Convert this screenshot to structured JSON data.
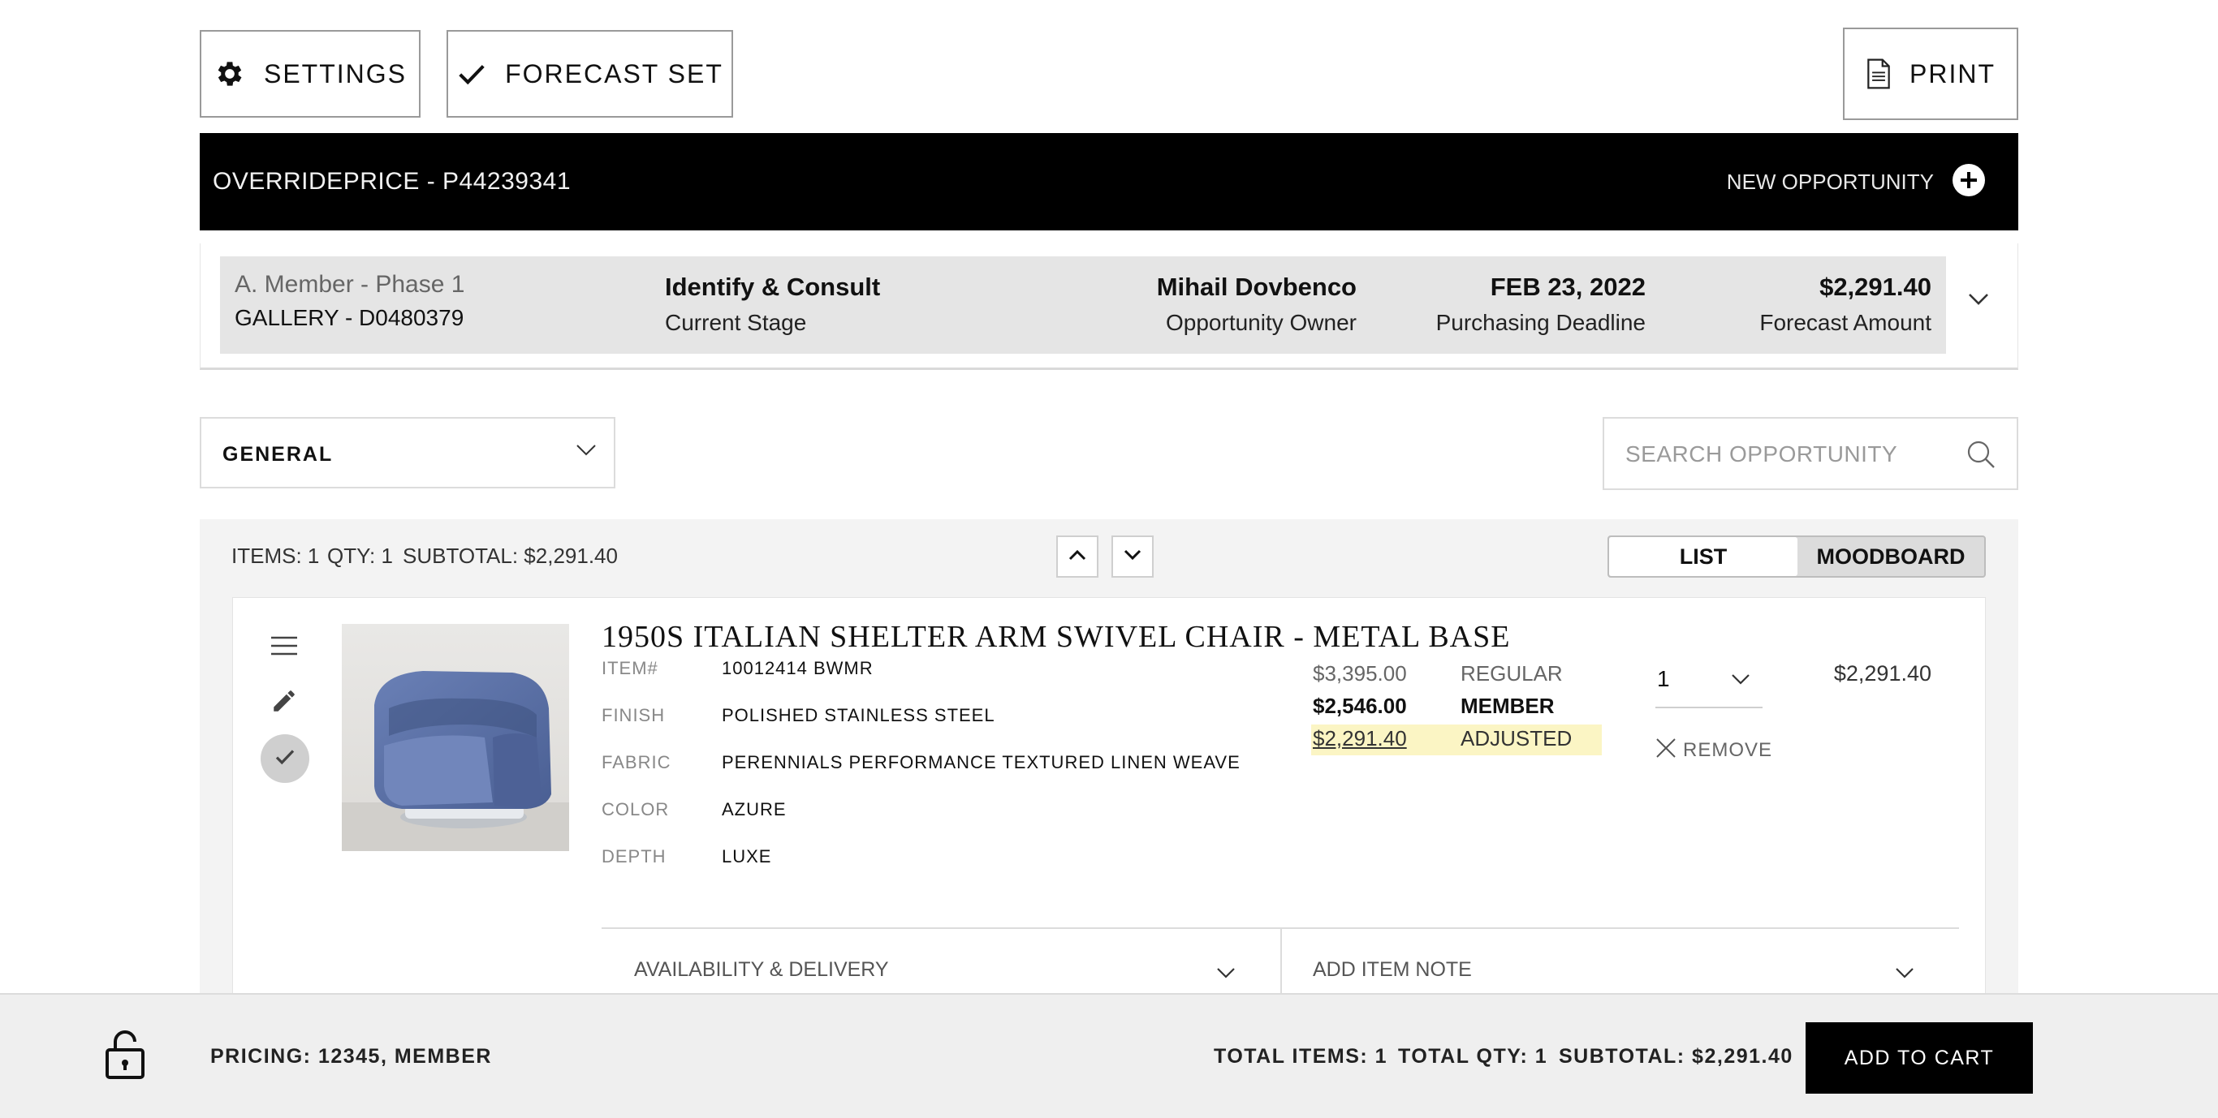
{
  "toolbar": {
    "settings_label": "SETTINGS",
    "forecast_label": "FORECAST SET",
    "print_label": "PRINT"
  },
  "header_bar": {
    "title": "OVERRIDEPRICE - P44239341",
    "new_opportunity_label": "NEW OPPORTUNITY"
  },
  "summary": {
    "member": "A. Member - Phase 1",
    "gallery": "GALLERY - D0480379",
    "stage_value": "Identify & Consult",
    "stage_label": "Current Stage",
    "owner_value": "Mihail Dovbenco",
    "owner_label": "Opportunity Owner",
    "deadline_value": "FEB 23, 2022",
    "deadline_label": "Purchasing Deadline",
    "forecast_value": "$2,291.40",
    "forecast_label": "Forecast Amount"
  },
  "filters": {
    "category_selected": "GENERAL",
    "search_placeholder": "SEARCH OPPORTUNITY"
  },
  "items_header": {
    "items": "ITEMS: 1",
    "qty": "QTY: 1",
    "subtotal": "SUBTOTAL: $2,291.40",
    "view_list": "LIST",
    "view_moodboard": "MOODBOARD"
  },
  "item": {
    "title": "1950S ITALIAN SHELTER ARM SWIVEL CHAIR - METAL BASE",
    "specs": [
      {
        "label": "ITEM#",
        "value": "10012414 BWMR"
      },
      {
        "label": "FINISH",
        "value": "POLISHED STAINLESS STEEL"
      },
      {
        "label": "FABRIC",
        "value": "PERENNIALS PERFORMANCE TEXTURED LINEN WEAVE"
      },
      {
        "label": "COLOR",
        "value": "AZURE"
      },
      {
        "label": "DEPTH",
        "value": "LUXE"
      }
    ],
    "prices": {
      "regular_price": "$3,395.00",
      "regular_label": "REGULAR",
      "member_price": "$2,546.00",
      "member_label": "MEMBER",
      "adjusted_price": "$2,291.40",
      "adjusted_label": "ADJUSTED"
    },
    "quantity": "1",
    "remove_label": "REMOVE",
    "line_total": "$2,291.40",
    "availability_label": "AVAILABILITY & DELIVERY",
    "note_label": "ADD ITEM NOTE"
  },
  "footer": {
    "pricing": "PRICING: 12345, MEMBER",
    "total_items": "TOTAL ITEMS: 1",
    "total_qty": "TOTAL QTY: 1",
    "subtotal": "SUBTOTAL: $2,291.40",
    "add_to_cart": "ADD TO CART"
  },
  "colors": {
    "black": "#000000",
    "adjusted_highlight": "#fbf5c4",
    "chair_blue": "#5b72a8",
    "panel_grey": "#f3f3f3"
  },
  "icons": [
    "gear-icon",
    "check-icon",
    "document-icon",
    "plus-circle-icon",
    "chevron-down-icon",
    "chevron-up-icon",
    "search-icon",
    "menu-icon",
    "pencil-icon",
    "close-icon",
    "lock-icon"
  ]
}
